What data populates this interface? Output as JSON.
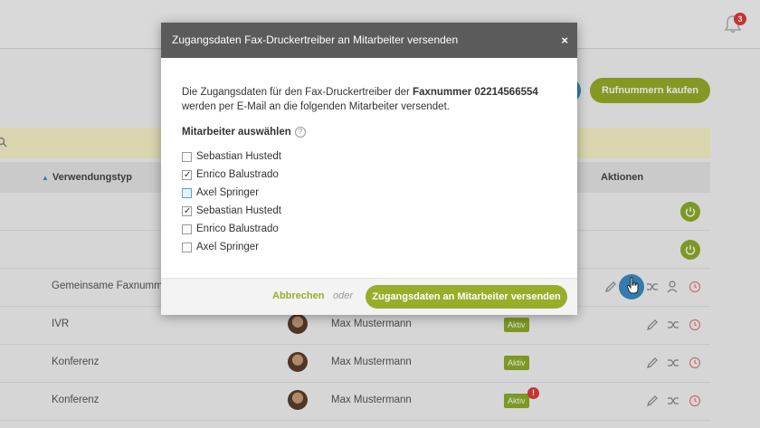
{
  "header": {
    "notification_count": "3"
  },
  "toolbar": {
    "buy_numbers_label": "Rufnummern kaufen"
  },
  "table": {
    "headers": {
      "usage_type": "Verwendungstyp",
      "actions": "Aktionen"
    },
    "rows": [
      {
        "type": "",
        "name": "",
        "status": ""
      },
      {
        "type": "",
        "name": "",
        "status": ""
      },
      {
        "type": "Gemeinsame Faxnummer",
        "name": "",
        "status": ""
      },
      {
        "type": "IVR",
        "name": "Max Mustermann",
        "status": "Aktiv"
      },
      {
        "type": "Konferenz",
        "name": "Max Mustermann",
        "status": "Aktiv"
      },
      {
        "type": "Konferenz",
        "name": "Max Mustermann",
        "status": "Aktiv",
        "alert": "!"
      }
    ]
  },
  "modal": {
    "title": "Zugangsdaten Fax-Druckertreiber an Mitarbeiter versenden",
    "close_symbol": "×",
    "description_pre": "Die Zugangsdaten für den Fax-Druckertreiber der ",
    "description_bold": "Faxnummer 02214566554",
    "description_post": " werden per E-Mail an die folgenden Mitarbeiter versendet.",
    "select_label": "Mitarbeiter auswählen",
    "help_symbol": "?",
    "employees": [
      {
        "name": "Sebastian Hustedt",
        "checked": false,
        "focused": false
      },
      {
        "name": "Enrico Balustrado",
        "checked": true,
        "focused": false
      },
      {
        "name": "Axel Springer",
        "checked": false,
        "focused": true
      },
      {
        "name": "Sebastian Hustedt",
        "checked": true,
        "focused": false
      },
      {
        "name": "Enrico Balustrado",
        "checked": false,
        "focused": false
      },
      {
        "name": "Axel Springer",
        "checked": false,
        "focused": false
      }
    ],
    "cancel_label": "Abbrechen",
    "or_label": "oder",
    "send_label": "Zugangsdaten an Mitarbeiter versenden"
  },
  "colors": {
    "accent_green": "#98ad2a",
    "status_green": "#8fae2a",
    "modal_header": "#5b5b5b",
    "alert_red": "#e23b3b",
    "blue": "#3a8fc7"
  }
}
